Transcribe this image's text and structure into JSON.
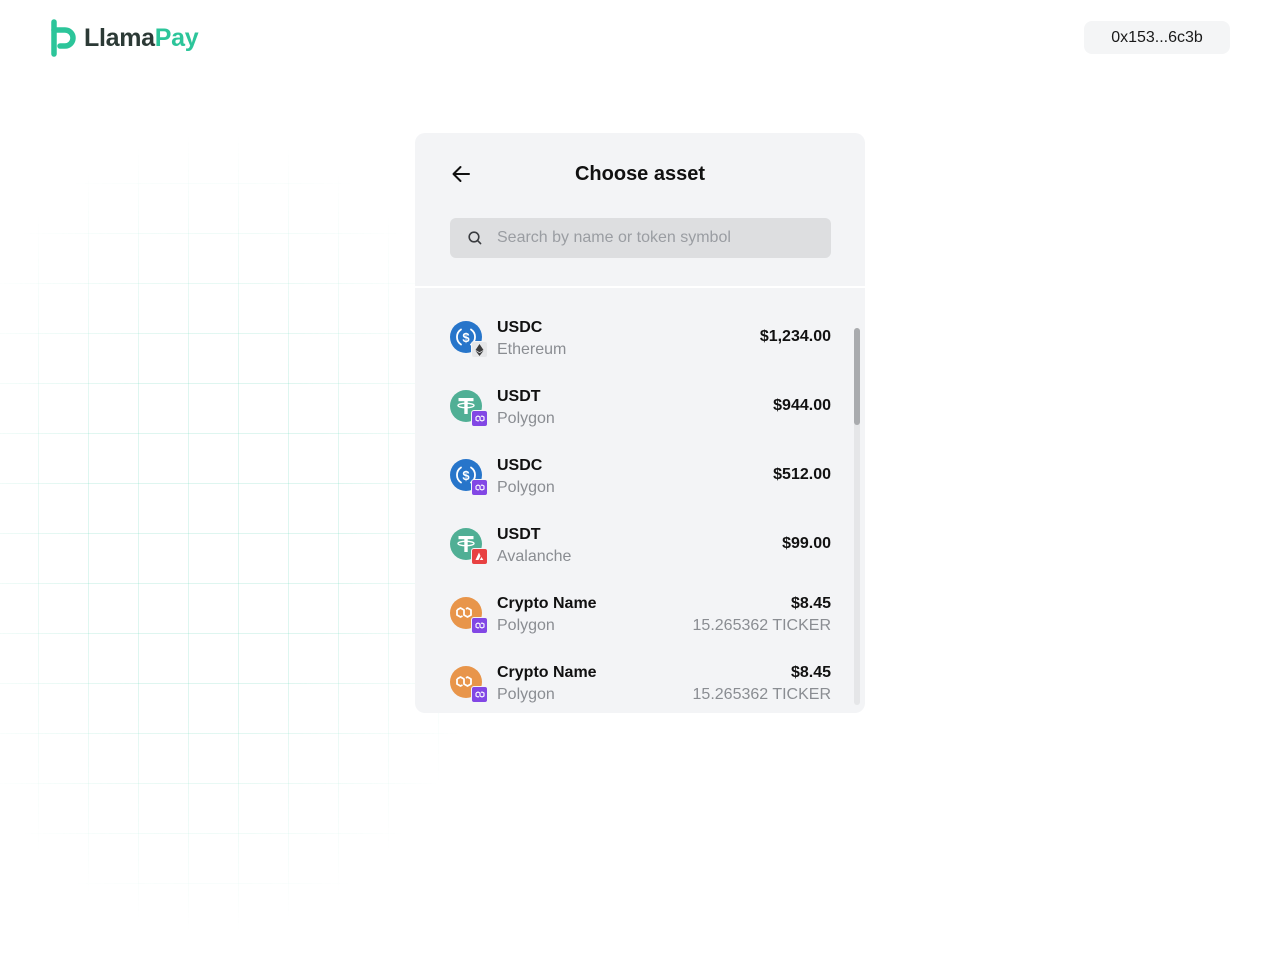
{
  "header": {
    "logo": {
      "part1": "Llama",
      "part2": "Pay",
      "icon": "llamapay-logo-icon"
    },
    "wallet_address": "0x153...6c3b"
  },
  "panel": {
    "title": "Choose asset",
    "back_icon": "arrow-left-icon",
    "search": {
      "placeholder": "Search by name or token symbol",
      "value": "",
      "icon": "search-icon"
    }
  },
  "assets": [
    {
      "symbol": "USDC",
      "chain": "Ethereum",
      "value": "$1,234.00",
      "amount": "",
      "token_icon": "usdc-icon",
      "chain_icon": "ethereum-icon"
    },
    {
      "symbol": "USDT",
      "chain": "Polygon",
      "value": "$944.00",
      "amount": "",
      "token_icon": "usdt-icon",
      "chain_icon": "polygon-icon"
    },
    {
      "symbol": "USDC",
      "chain": "Polygon",
      "value": "$512.00",
      "amount": "",
      "token_icon": "usdc-icon",
      "chain_icon": "polygon-icon"
    },
    {
      "symbol": "USDT",
      "chain": "Avalanche",
      "value": "$99.00",
      "amount": "",
      "token_icon": "usdt-icon",
      "chain_icon": "avalanche-icon"
    },
    {
      "symbol": "Crypto Name",
      "chain": "Polygon",
      "value": "$8.45",
      "amount": "15.265362 TICKER",
      "token_icon": "crypto-token-icon",
      "chain_icon": "polygon-icon"
    },
    {
      "symbol": "Crypto Name",
      "chain": "Polygon",
      "value": "$8.45",
      "amount": "15.265362 TICKER",
      "token_icon": "crypto-token-icon",
      "chain_icon": "polygon-icon"
    }
  ],
  "colors": {
    "brand_green": "#2cc59a",
    "brand_dark": "#2c3a36",
    "usdc_blue": "#2775ca",
    "usdt_green": "#50af95",
    "polygon_purple": "#8247e5",
    "avalanche_red": "#e84142",
    "crypto_orange": "#e8954a"
  }
}
